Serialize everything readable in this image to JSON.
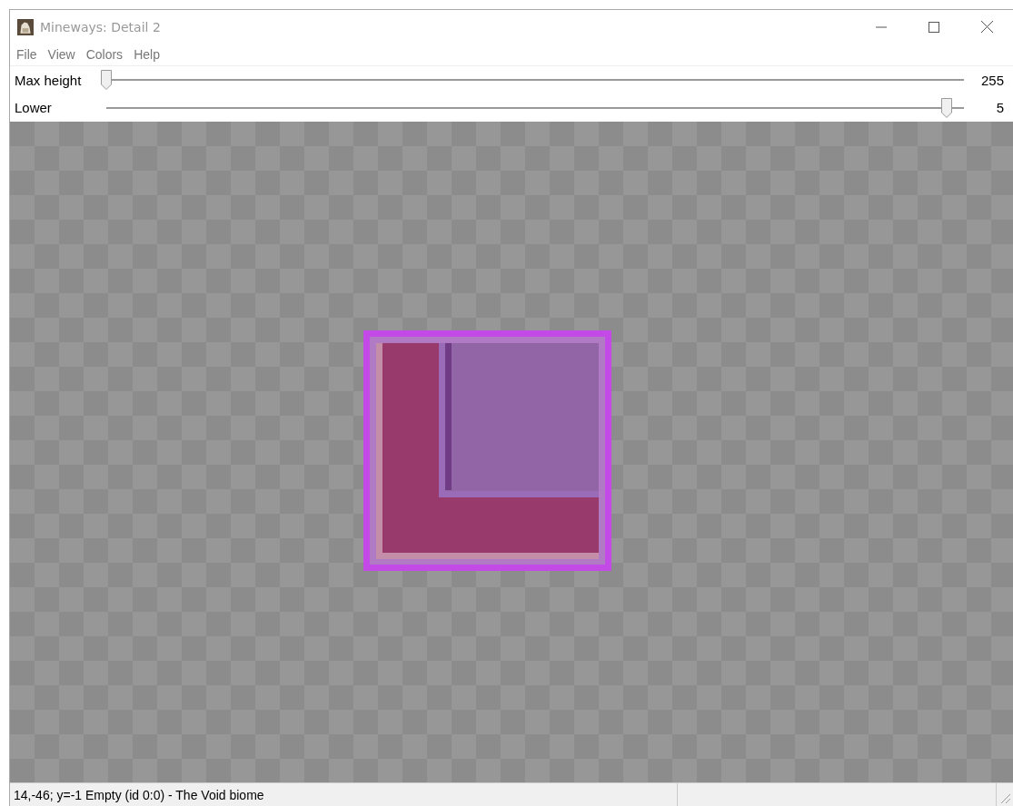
{
  "window": {
    "title": "Mineways: Detail 2"
  },
  "menu": [
    "File",
    "View",
    "Colors",
    "Help"
  ],
  "sliders": [
    {
      "label": "Max height",
      "level": 0.0,
      "reading": "255"
    },
    {
      "label": "Lower",
      "level": 0.98,
      "reading": "5"
    }
  ],
  "status_bar": {
    "text": "14,-46; y=-1 Empty (id 0:0) - The Void biome"
  }
}
